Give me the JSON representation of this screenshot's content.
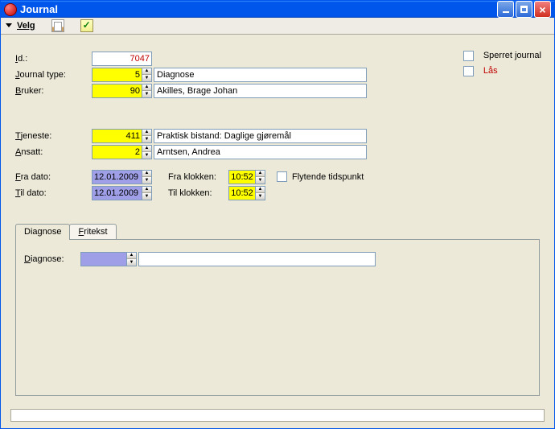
{
  "window": {
    "title": "Journal"
  },
  "toolbar": {
    "velg": "Velg"
  },
  "rightChecks": {
    "sperret": "Sperret journal",
    "las_prefix": "L",
    "las_rest": "ås"
  },
  "fields": {
    "id_label_prefix": "I",
    "id_label_rest": "d.:",
    "id_value": "7047",
    "journaltype_label_prefix": "J",
    "journaltype_label_rest": "ournal type:",
    "journaltype_value": "5",
    "journaltype_desc": "Diagnose",
    "bruker_label_prefix": "B",
    "bruker_label_rest": "ruker:",
    "bruker_value": "90",
    "bruker_desc": "Akilles, Brage Johan",
    "tjeneste_label_prefix": "T",
    "tjeneste_label_rest": "jeneste:",
    "tjeneste_value": "411",
    "tjeneste_desc": "Praktisk bistand: Daglige gjøremål",
    "ansatt_label_prefix": "A",
    "ansatt_label_rest": "nsatt:",
    "ansatt_value": "2",
    "ansatt_desc": "Arntsen, Andrea",
    "fradato_label_prefix": "F",
    "fradato_label_rest": "ra dato:",
    "fradato_value": "12.01.2009",
    "fraklokken_label": "Fra klokken:",
    "fraklokken_value": "10:52",
    "flytende_label": "Flytende tidspunkt",
    "tildato_label_prefix": "T",
    "tildato_label_rest": "il dato:",
    "tildato_value": "12.01.2009",
    "tilklokken_label": "Til klokken:",
    "tilklokken_value": "10:52"
  },
  "tabs": {
    "diagnose": "Diagnose",
    "fritekst_prefix": "F",
    "fritekst_rest": "ritekst"
  },
  "tabpanel": {
    "diagnose_label_prefix": "D",
    "diagnose_label_rest": "iagnose:",
    "diagnose_value": "",
    "diagnose_desc": ""
  }
}
